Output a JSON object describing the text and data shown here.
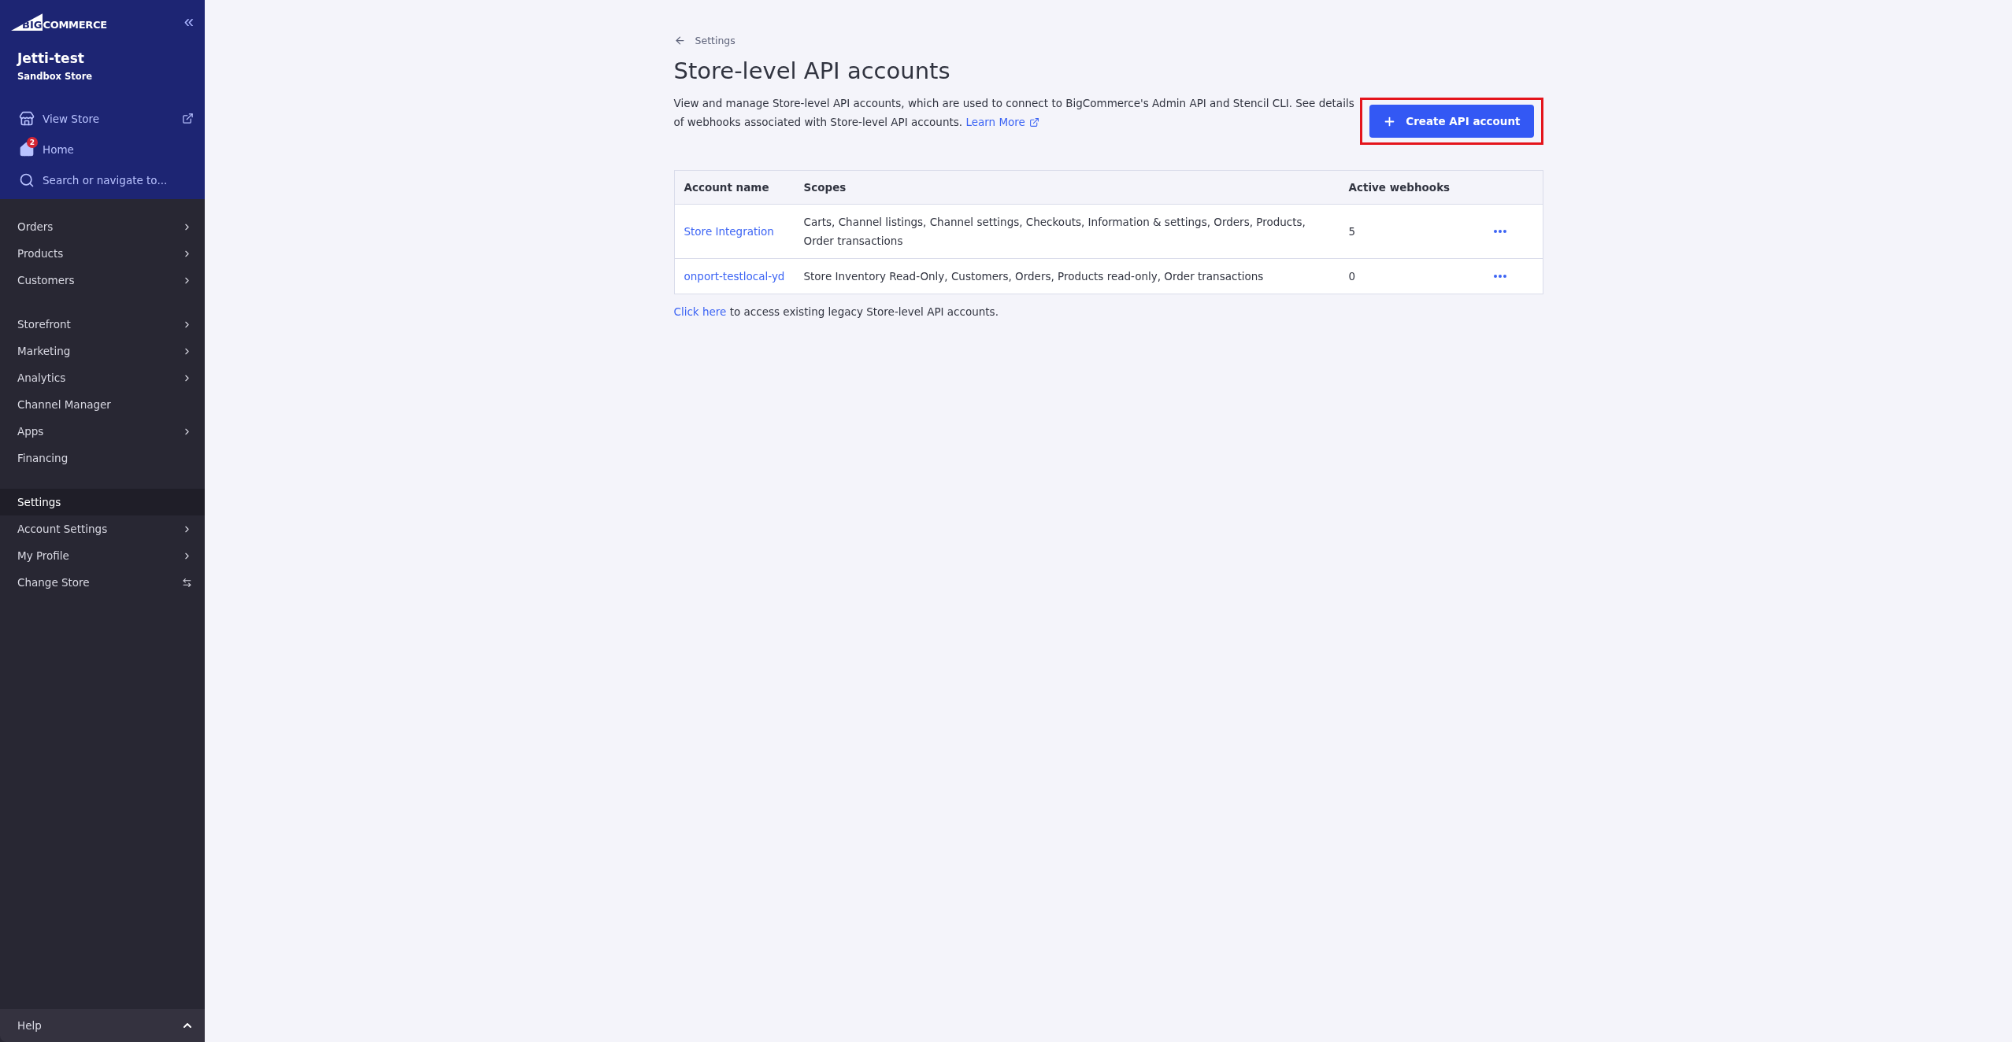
{
  "sidebar": {
    "logo": {
      "mark": "BIG",
      "word": "COMMERCE"
    },
    "collapse_icon": "«",
    "store": {
      "name": "Jetti-test",
      "type": "Sandbox Store"
    },
    "quick_links": [
      {
        "kind": "view_store",
        "label": "View Store"
      },
      {
        "kind": "home",
        "label": "Home",
        "badge": "2"
      },
      {
        "kind": "search",
        "label": "Search or navigate to..."
      }
    ],
    "groups": [
      {
        "items": [
          {
            "label": "Orders",
            "kind": "submenu"
          },
          {
            "label": "Products",
            "kind": "submenu"
          },
          {
            "label": "Customers",
            "kind": "submenu"
          }
        ]
      },
      {
        "items": [
          {
            "label": "Storefront",
            "kind": "submenu"
          },
          {
            "label": "Marketing",
            "kind": "submenu"
          },
          {
            "label": "Analytics",
            "kind": "submenu"
          },
          {
            "label": "Channel Manager",
            "kind": "link"
          },
          {
            "label": "Apps",
            "kind": "submenu"
          },
          {
            "label": "Financing",
            "kind": "link"
          }
        ]
      },
      {
        "header": "Settings",
        "items": [
          {
            "label": "Account Settings",
            "kind": "submenu"
          },
          {
            "label": "My Profile",
            "kind": "submenu"
          },
          {
            "label": "Change Store",
            "kind": "switch"
          }
        ]
      }
    ],
    "help": {
      "label": "Help",
      "expanded": false
    }
  },
  "breadcrumb": "Settings",
  "title": "Store-level API accounts",
  "description": "View and manage Store-level API accounts, which are used to connect to BigCommerce's Admin API and Stencil CLI. See details of webhooks associated with Store-level API accounts.",
  "learn_more": "Learn More",
  "create_button": {
    "label": "Create API account",
    "highlighted": true
  },
  "table": {
    "columns": [
      "Account name",
      "Scopes",
      "Active webhooks"
    ],
    "rows": [
      {
        "name": "Store Integration",
        "scopes": "Carts, Channel listings, Channel settings, Checkouts, Information & settings, Orders, Products, Order transactions",
        "webhooks": "5"
      },
      {
        "name": "onport-testlocal-yd",
        "scopes": "Store Inventory Read-Only, Customers, Orders, Products read-only, Order transactions",
        "webhooks": "0"
      }
    ]
  },
  "footer": {
    "link": "Click here",
    "text": "to access existing legacy Store-level API accounts."
  }
}
